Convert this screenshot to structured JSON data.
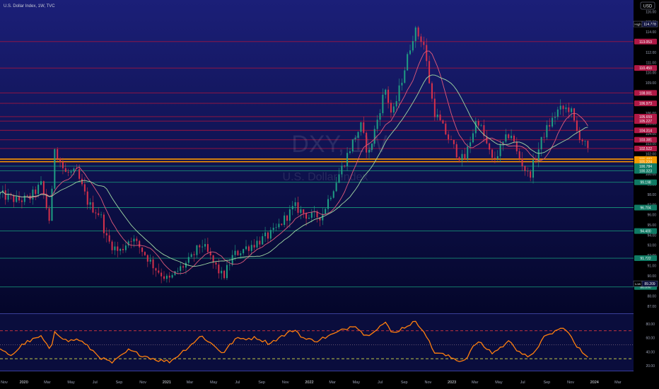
{
  "header": {
    "title": "U.S. Dollar Index, 1W, TVC",
    "currency_button": "USD"
  },
  "watermark": {
    "symbol": "DXY, 1W",
    "name": "U.S. Dollar Index"
  },
  "badges": {
    "high_label": "High",
    "high_value": "114.778",
    "low_label": "Low",
    "low_value": "89.209"
  },
  "colors": {
    "bg_top": "#1b1f78",
    "bg_bottom": "#04062a",
    "red_level": "#b7143b",
    "green_level": "#19a07e",
    "orange_level": "#ff9800",
    "bull": "#1f9e84",
    "bear": "#d5314b",
    "ma_fast": "#e05a7b",
    "ma_slow": "#9fd7a4",
    "rsi_line": "#ff7f0e",
    "rsi_dash_red": "#d9363e",
    "rsi_dash_yellow": "#d7e04a"
  },
  "chart_data": [
    {
      "type": "candlestick",
      "symbol": "DXY",
      "timeframe": "1W",
      "y_axis": {
        "min": 86.5,
        "max": 116.8,
        "ticks": [
          87.0,
          88.0,
          89.0,
          90.0,
          91.0,
          92.0,
          93.0,
          94.0,
          95.0,
          96.0,
          97.0,
          98.0,
          99.0,
          100.0,
          101.0,
          102.0,
          103.0,
          104.0,
          105.0,
          106.0,
          107.0,
          108.0,
          109.0,
          110.0,
          111.0,
          112.0,
          113.0,
          114.0,
          115.0,
          116.0
        ]
      },
      "x_axis": {
        "range": [
          "2019-11-01",
          "2024-04-10"
        ],
        "labels": [
          {
            "d": "2019-11-01",
            "t": "Nov"
          },
          {
            "d": "2020-01-01",
            "t": "2020"
          },
          {
            "d": "2020-03-01",
            "t": "Mar"
          },
          {
            "d": "2020-05-01",
            "t": "May"
          },
          {
            "d": "2020-07-01",
            "t": "Jul"
          },
          {
            "d": "2020-09-01",
            "t": "Sep"
          },
          {
            "d": "2020-11-01",
            "t": "Nov"
          },
          {
            "d": "2021-01-01",
            "t": "2021"
          },
          {
            "d": "2021-03-01",
            "t": "Mar"
          },
          {
            "d": "2021-05-01",
            "t": "May"
          },
          {
            "d": "2021-07-01",
            "t": "Jul"
          },
          {
            "d": "2021-09-01",
            "t": "Sep"
          },
          {
            "d": "2021-11-01",
            "t": "Nov"
          },
          {
            "d": "2022-01-01",
            "t": "2022"
          },
          {
            "d": "2022-03-01",
            "t": "Mar"
          },
          {
            "d": "2022-05-01",
            "t": "May"
          },
          {
            "d": "2022-07-01",
            "t": "Jul"
          },
          {
            "d": "2022-09-01",
            "t": "Sep"
          },
          {
            "d": "2022-11-01",
            "t": "Nov"
          },
          {
            "d": "2023-01-01",
            "t": "2023"
          },
          {
            "d": "2023-03-01",
            "t": "Mar"
          },
          {
            "d": "2023-05-01",
            "t": "May"
          },
          {
            "d": "2023-07-01",
            "t": "Jul"
          },
          {
            "d": "2023-09-01",
            "t": "Sep"
          },
          {
            "d": "2023-11-01",
            "t": "Nov"
          },
          {
            "d": "2024-01-01",
            "t": "2024"
          },
          {
            "d": "2024-03-01",
            "t": "Mar"
          }
        ]
      },
      "price_path": [
        [
          "2019-11-01",
          98.0
        ],
        [
          "2019-12-15",
          97.4
        ],
        [
          "2020-01-15",
          97.6
        ],
        [
          "2020-02-15",
          99.0
        ],
        [
          "2020-03-09",
          95.0
        ],
        [
          "2020-03-19",
          102.8
        ],
        [
          "2020-04-15",
          100.1
        ],
        [
          "2020-05-15",
          100.1
        ],
        [
          "2020-06-15",
          97.0
        ],
        [
          "2020-07-15",
          96.0
        ],
        [
          "2020-08-01",
          93.5
        ],
        [
          "2020-09-01",
          92.3
        ],
        [
          "2020-10-01",
          93.8
        ],
        [
          "2020-11-01",
          92.4
        ],
        [
          "2020-12-01",
          90.8
        ],
        [
          "2021-01-06",
          89.5
        ],
        [
          "2021-02-01",
          90.6
        ],
        [
          "2021-03-01",
          91.5
        ],
        [
          "2021-03-31",
          93.2
        ],
        [
          "2021-05-01",
          91.2
        ],
        [
          "2021-05-25",
          89.8
        ],
        [
          "2021-06-20",
          92.0
        ],
        [
          "2021-07-15",
          92.6
        ],
        [
          "2021-08-20",
          93.3
        ],
        [
          "2021-09-30",
          94.2
        ],
        [
          "2021-11-24",
          96.8
        ],
        [
          "2021-12-31",
          95.8
        ],
        [
          "2022-02-01",
          95.9
        ],
        [
          "2022-03-07",
          99.0
        ],
        [
          "2022-04-28",
          103.7
        ],
        [
          "2022-05-13",
          104.7
        ],
        [
          "2022-06-01",
          101.8
        ],
        [
          "2022-07-14",
          108.5
        ],
        [
          "2022-08-01",
          105.6
        ],
        [
          "2022-09-27",
          114.2
        ],
        [
          "2022-10-20",
          113.0
        ],
        [
          "2022-11-15",
          106.3
        ],
        [
          "2022-12-15",
          104.1
        ],
        [
          "2023-01-15",
          102.0
        ],
        [
          "2023-02-01",
          101.3
        ],
        [
          "2023-03-07",
          105.6
        ],
        [
          "2023-04-15",
          101.2
        ],
        [
          "2023-05-31",
          104.2
        ],
        [
          "2023-06-15",
          102.2
        ],
        [
          "2023-07-17",
          99.7
        ],
        [
          "2023-08-25",
          104.0
        ],
        [
          "2023-09-30",
          106.3
        ],
        [
          "2023-10-31",
          106.5
        ],
        [
          "2023-11-15",
          104.3
        ],
        [
          "2023-12-04",
          103.2
        ],
        [
          "2023-12-20",
          101.8
        ]
      ],
      "horizontal_levels": [
        {
          "value": 113.053,
          "label": "113.053",
          "color": "red"
        },
        {
          "value": 110.45,
          "label": "110.450",
          "color": "red"
        },
        {
          "value": 108.001,
          "label": "108.001",
          "color": "red"
        },
        {
          "value": 106.973,
          "label": "106.973",
          "color": "red"
        },
        {
          "value": 105.659,
          "label": "105.659",
          "color": "red"
        },
        {
          "value": 105.227,
          "label": "105.227",
          "color": "red"
        },
        {
          "value": 104.314,
          "label": "104.314",
          "color": "red"
        },
        {
          "value": 103.381,
          "label": "103.381",
          "color": "red"
        },
        {
          "value": 102.522,
          "label": "102.522",
          "color": "red"
        },
        {
          "value": 101.483,
          "label": "101.483",
          "color": "orange"
        },
        {
          "value": 101.224,
          "label": "101.224",
          "color": "orange"
        },
        {
          "value": 100.784,
          "label": "100.784",
          "color": "green"
        },
        {
          "value": 100.323,
          "label": "100.323",
          "color": "green"
        },
        {
          "value": 99.198,
          "label": "99.198",
          "color": "green"
        },
        {
          "value": 96.704,
          "label": "96.704",
          "color": "green"
        },
        {
          "value": 94.4,
          "label": "94.400",
          "color": "green"
        },
        {
          "value": 91.722,
          "label": "91.722",
          "color": "green"
        },
        {
          "value": 88.89,
          "label": "88.890",
          "color": "green"
        }
      ],
      "high": 114.778,
      "low": 89.209
    },
    {
      "type": "line",
      "name": "RSI",
      "y_axis": {
        "min": 15,
        "max": 92,
        "ticks": [
          20.0,
          40.0,
          60.0,
          80.0
        ]
      },
      "overbought": 70,
      "middle": 50,
      "oversold": 30,
      "values": [
        [
          "2019-11-01",
          42
        ],
        [
          "2019-12-01",
          35
        ],
        [
          "2020-01-01",
          52
        ],
        [
          "2020-02-15",
          62
        ],
        [
          "2020-03-09",
          40
        ],
        [
          "2020-03-20",
          70
        ],
        [
          "2020-04-20",
          55
        ],
        [
          "2020-05-20",
          58
        ],
        [
          "2020-06-20",
          44
        ],
        [
          "2020-07-20",
          30
        ],
        [
          "2020-08-15",
          24
        ],
        [
          "2020-09-25",
          42
        ],
        [
          "2020-10-25",
          36
        ],
        [
          "2020-12-10",
          28
        ],
        [
          "2021-01-10",
          26
        ],
        [
          "2021-02-10",
          40
        ],
        [
          "2021-03-31",
          63
        ],
        [
          "2021-05-25",
          38
        ],
        [
          "2021-06-25",
          58
        ],
        [
          "2021-08-20",
          60
        ],
        [
          "2021-09-20",
          52
        ],
        [
          "2021-11-24",
          72
        ],
        [
          "2021-12-20",
          58
        ],
        [
          "2022-01-20",
          56
        ],
        [
          "2022-03-07",
          66
        ],
        [
          "2022-04-28",
          79
        ],
        [
          "2022-05-25",
          62
        ],
        [
          "2022-07-14",
          82
        ],
        [
          "2022-08-01",
          66
        ],
        [
          "2022-09-27",
          83
        ],
        [
          "2022-10-20",
          72
        ],
        [
          "2022-11-15",
          40
        ],
        [
          "2022-12-15",
          35
        ],
        [
          "2023-01-15",
          28
        ],
        [
          "2023-02-01",
          27
        ],
        [
          "2023-03-07",
          55
        ],
        [
          "2023-04-15",
          38
        ],
        [
          "2023-05-31",
          56
        ],
        [
          "2023-06-15",
          44
        ],
        [
          "2023-07-17",
          30
        ],
        [
          "2023-08-25",
          60
        ],
        [
          "2023-09-30",
          72
        ],
        [
          "2023-10-20",
          73
        ],
        [
          "2023-11-15",
          48
        ],
        [
          "2023-12-04",
          38
        ],
        [
          "2023-12-20",
          32
        ]
      ],
      "x_labels_bottom": [
        "Nov",
        "2020",
        "Mar",
        "May",
        "Jul",
        "Sep",
        "Nov",
        "2021",
        "Mar",
        "May",
        "Jul",
        "Sep",
        "Nov",
        "2022",
        "Mar",
        "May",
        "Jul",
        "Sep",
        "Nov",
        "2023",
        "Mar",
        "May",
        "Jul",
        "Sep",
        "Nov",
        "2024",
        "Mar"
      ]
    }
  ]
}
